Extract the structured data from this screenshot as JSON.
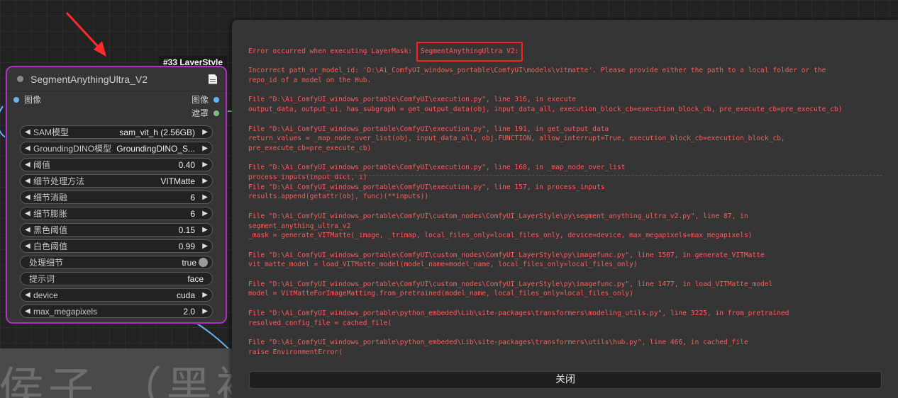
{
  "node": {
    "badge": "#33 LayerStyle",
    "title": "SegmentAnythingUltra_V2",
    "input_label": "图像",
    "outputs": [
      "图像",
      "遮罩"
    ],
    "widgets": [
      {
        "label": "SAM模型",
        "value": "sam_vit_h (2.56GB)",
        "arrows": true
      },
      {
        "label": "GroundingDINO模型",
        "value": "GroundingDINO_S...",
        "arrows": true
      },
      {
        "label": "阈值",
        "value": "0.40",
        "arrows": true
      },
      {
        "label": "细节处理方法",
        "value": "VITMatte",
        "arrows": true
      },
      {
        "label": "细节消融",
        "value": "6",
        "arrows": true
      },
      {
        "label": "细节膨胀",
        "value": "6",
        "arrows": true
      },
      {
        "label": "黑色阈值",
        "value": "0.15",
        "arrows": true
      },
      {
        "label": "白色阈值",
        "value": "0.99",
        "arrows": true
      },
      {
        "label": "处理细节",
        "value": "true",
        "toggle": true
      },
      {
        "label": "提示词",
        "value": "face"
      },
      {
        "label": "device",
        "value": "cuda",
        "arrows": true
      },
      {
        "label": "max_megapixels",
        "value": "2.0",
        "arrows": true
      }
    ]
  },
  "group_title": "侯子 （黑袍",
  "dialog": {
    "first_line_prefix": "Error occurred when executing LayerMask: ",
    "first_line_highlight": "SegmentAnythingUltra V2:",
    "lines": [
      "Incorrect path_or_model_id: 'D:\\Ai_ComfyUI_windows_portable\\ComfyUI\\models\\vitmatte'. Please provide either the path to a local folder or the",
      "repo_id of a model on the Hub.",
      "",
      "File \"D:\\Ai_ComfyUI_windows_portable\\ComfyUI\\execution.py\", line 316, in execute",
      "output_data, output_ui, has_subgraph = get_output_data(obj, input_data_all, execution_block_cb=execution_block_cb, pre_execute_cb=pre_execute_cb)",
      "",
      "File \"D:\\Ai_ComfyUI_windows_portable\\ComfyUI\\execution.py\", line 191, in get_output_data",
      "return_values = _map_node_over_list(obj, input_data_all, obj.FUNCTION, allow_interrupt=True, execution_block_cb=execution_block_cb,",
      "pre_execute_cb=pre_execute_cb)",
      "",
      "File \"D:\\Ai_ComfyUI_windows_portable\\ComfyUI\\execution.py\", line 168, in _map_node_over_list",
      "process_inputs(input_dict, i)",
      "File \"D:\\Ai_ComfyUI_windows_portable\\ComfyUI\\execution.py\", line 157, in process_inputs",
      "results.append(getattr(obj, func)(**inputs))",
      "",
      "File \"D:\\Ai_ComfyUI_windows_portable\\ComfyUI\\custom_nodes\\ComfyUI_LayerStyle\\py\\segment_anything_ultra_v2.py\", line 87, in",
      "segment_anything_ultra_v2",
      "_mask = generate_VITMatte(_image, _trimap, local_files_only=local_files_only, device=device, max_megapixels=max_megapixels)",
      "",
      "File \"D:\\Ai_ComfyUI_windows_portable\\ComfyUI\\custom_nodes\\ComfyUI_LayerStyle\\py\\imagefunc.py\", line 1507, in generate_VITMatte",
      "vit_matte_model = load_VITMatte_model(model_name=model_name, local_files_only=local_files_only)",
      "",
      "File \"D:\\Ai_ComfyUI_windows_portable\\ComfyUI\\custom_nodes\\ComfyUI_LayerStyle\\py\\imagefunc.py\", line 1477, in load_VITMatte_model",
      "model = VitMatteForImageMatting.from_pretrained(model_name, local_files_only=local_files_only)",
      "",
      "File \"D:\\Ai_ComfyUI_windows_portable\\python_embeded\\Lib\\site-packages\\transformers\\modeling_utils.py\", line 3225, in from_pretrained",
      "resolved_config_file = cached_file(",
      "",
      "File \"D:\\Ai_ComfyUI_windows_portable\\python_embeded\\Lib\\site-packages\\transformers\\utils\\hub.py\", line 466, in cached_file",
      "raise EnvironmentError("
    ],
    "close_label": "关闭"
  }
}
